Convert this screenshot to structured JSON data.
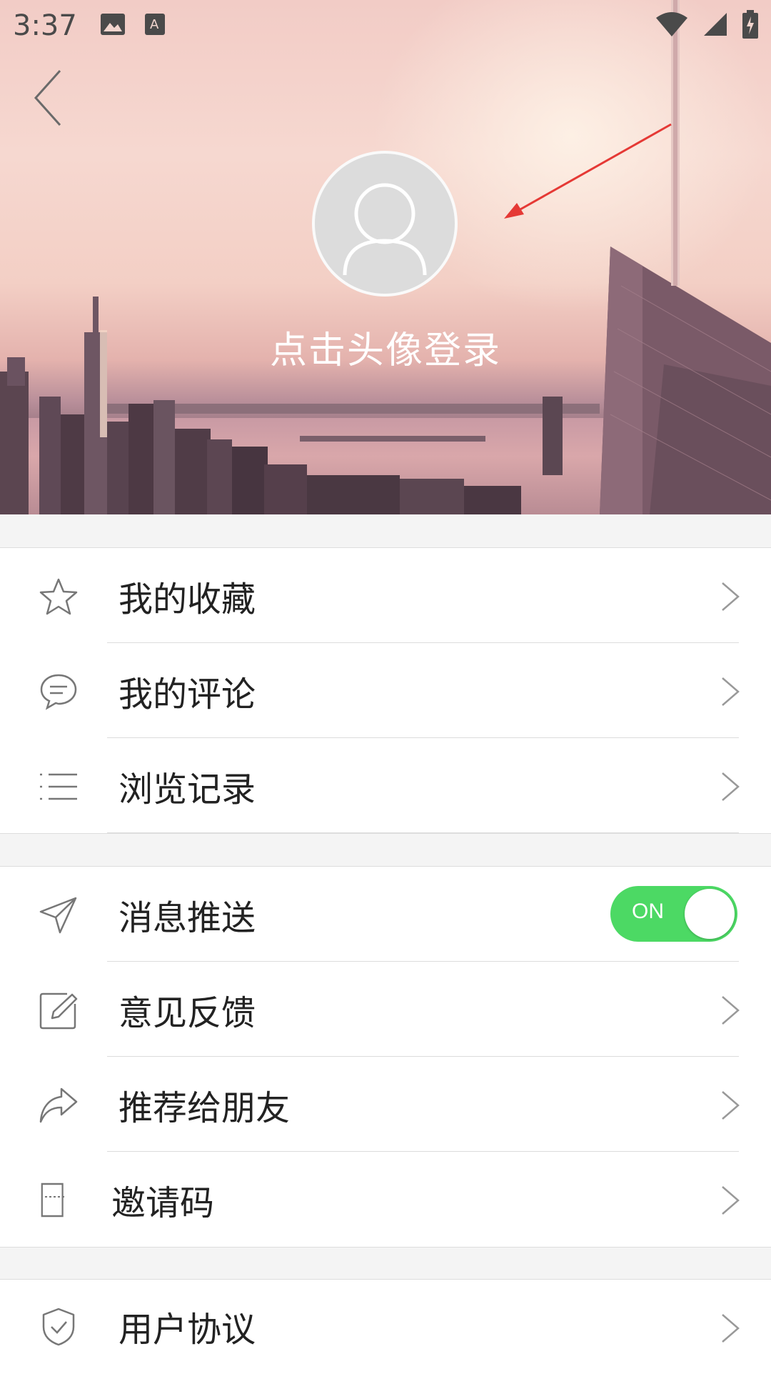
{
  "status_bar": {
    "time": "3:37",
    "icons_left": [
      "image-icon",
      "text-a-icon"
    ],
    "icons_right": [
      "wifi-icon",
      "cell-signal-icon",
      "battery-charging-icon"
    ]
  },
  "header": {
    "back_icon": "chevron-left-icon",
    "avatar_icon": "user-placeholder-icon",
    "login_hint": "点击头像登录"
  },
  "colors": {
    "toggle_on": "#4cd964",
    "annotation_arrow": "#e53935",
    "text_primary": "#222222",
    "separator": "#dcdcdc",
    "page_bg": "#f4f4f4"
  },
  "menu_groups": [
    {
      "items": [
        {
          "label": "我的收藏",
          "icon": "star-icon"
        },
        {
          "label": "我的评论",
          "icon": "comment-icon"
        },
        {
          "label": "浏览记录",
          "icon": "list-icon"
        }
      ]
    },
    {
      "items": [
        {
          "label": "消息推送",
          "icon": "paper-plane-icon",
          "toggle": {
            "state": "ON",
            "on": true
          }
        },
        {
          "label": "意见反馈",
          "icon": "edit-icon"
        },
        {
          "label": "推荐给朋友",
          "icon": "share-arrow-icon"
        },
        {
          "label": "邀请码",
          "icon": "ticket-icon"
        }
      ]
    },
    {
      "items": [
        {
          "label": "用户协议",
          "icon": "shield-check-icon"
        }
      ]
    }
  ]
}
